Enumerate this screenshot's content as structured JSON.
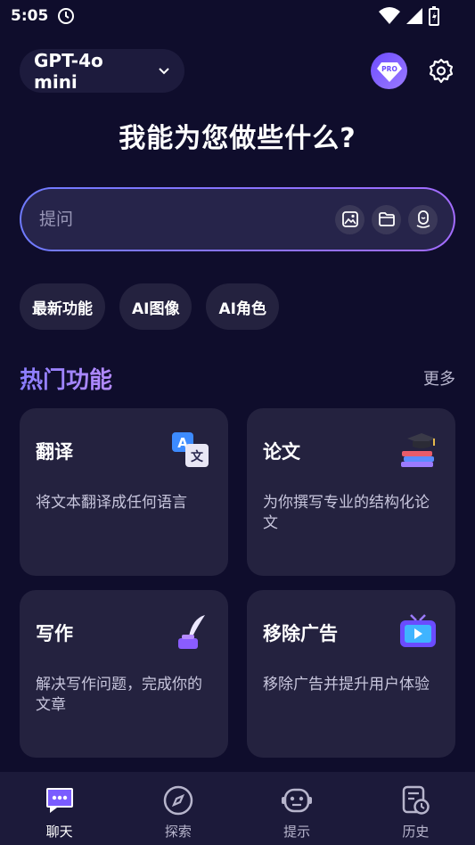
{
  "status_bar": {
    "time": "5:05"
  },
  "header": {
    "model_label": "GPT-4o mini",
    "pro_label": "PRO"
  },
  "headline": "我能为您做些什么?",
  "search": {
    "placeholder": "提问"
  },
  "chips": [
    "最新功能",
    "AI图像",
    "AI角色"
  ],
  "section": {
    "title": "热门功能",
    "more": "更多"
  },
  "cards": [
    {
      "title": "翻译",
      "desc": "将文本翻译成任何语言",
      "icon": "translate-icon"
    },
    {
      "title": "论文",
      "desc": "为你撰写专业的结构化论文",
      "icon": "books-icon"
    },
    {
      "title": "写作",
      "desc": "解决写作问题，完成你的文章",
      "icon": "quill-ink-icon"
    },
    {
      "title": "移除广告",
      "desc": "移除广告并提升用户体验",
      "icon": "tv-ad-icon"
    }
  ],
  "nav": [
    {
      "label": "聊天",
      "icon": "chat-bubble-icon",
      "active": true
    },
    {
      "label": "探索",
      "icon": "compass-icon"
    },
    {
      "label": "提示",
      "icon": "robot-icon"
    },
    {
      "label": "历史",
      "icon": "history-icon"
    }
  ],
  "colors": {
    "background": "#0f0d2c",
    "card": "#24223f",
    "accent": "#8a7dff"
  }
}
